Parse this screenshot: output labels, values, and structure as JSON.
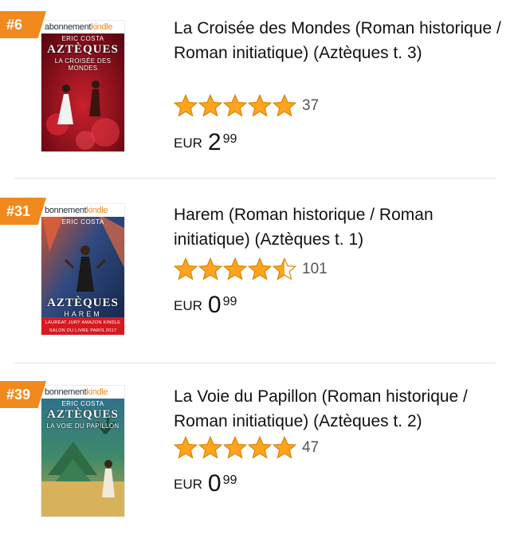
{
  "colors": {
    "badge": "#f08a1c",
    "star": "#ffa41c",
    "text": "#111111",
    "muted": "#555555"
  },
  "items": [
    {
      "rank": "#6",
      "cover": {
        "ku_prefix": "abonnement",
        "ku_brand": "kindle",
        "author": "ERIC COSTA",
        "series": "AZTÈQUES",
        "subtitle": "LA CROISÉE DES MONDES",
        "award": ""
      },
      "title": "La Croisée des Mondes (Roman historique / Roman initiatique) (Aztèques t. 3)",
      "rating": 5.0,
      "rating_count": "37",
      "price": {
        "currency": "EUR",
        "whole": "2",
        "fraction": "99"
      }
    },
    {
      "rank": "#31",
      "cover": {
        "ku_prefix": "bonnement",
        "ku_brand": "kindle",
        "author": "ERIC COSTA",
        "series": "AZTÈQUES",
        "subtitle": "HAREM",
        "award": "LAURÉAT JURY AMAZON KINDLE SALON DU LIVRE PARIS 2017"
      },
      "title": "Harem (Roman historique / Roman initiatique) (Aztèques t. 1)",
      "rating": 4.5,
      "rating_count": "101",
      "price": {
        "currency": "EUR",
        "whole": "0",
        "fraction": "99"
      }
    },
    {
      "rank": "#39",
      "cover": {
        "ku_prefix": "bonnement",
        "ku_brand": "kindle",
        "author": "ERIC COSTA",
        "series": "AZTÈQUES",
        "subtitle": "LA VOIE DU PAPILLON",
        "award": ""
      },
      "title": "La Voie du Papillon (Roman historique / Roman initiatique) (Aztèques t. 2)",
      "rating": 5.0,
      "rating_count": "47",
      "price": {
        "currency": "EUR",
        "whole": "0",
        "fraction": "99"
      }
    }
  ]
}
